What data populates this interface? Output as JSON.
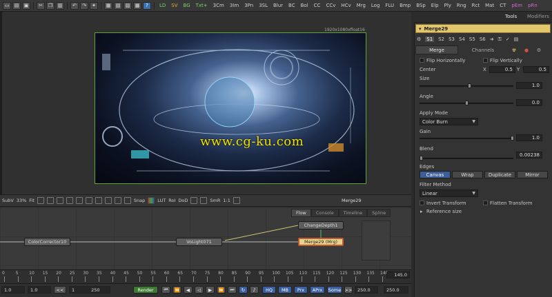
{
  "toolbar": {
    "tools": [
      "LD",
      "SV",
      "BG",
      "Txt+",
      "3Cm",
      "3Im",
      "3Pn",
      "3SL",
      "Blur",
      "BC",
      "Bol",
      "CC",
      "CCv",
      "HCv",
      "Mrg",
      "Log",
      "FLU",
      "Bmp",
      "BSp",
      "Elp",
      "Ply",
      "Rng",
      "Rct",
      "Mat",
      "CT",
      "pEm",
      "pRn"
    ]
  },
  "viewer": {
    "resolution": "1920x1080xfloat16",
    "watermark": "www.cg-ku.com"
  },
  "viewbar": {
    "subv": "SubV",
    "zoom": "33%",
    "fit": "Fit",
    "snap": "Snap",
    "lut": "LUT",
    "roi": "RoI",
    "dod": "DoD",
    "smr": "SmR",
    "ratio": "1:1",
    "title": "Merge29"
  },
  "flow": {
    "tabs": [
      "Flow",
      "Console",
      "Timeline",
      "Spline"
    ],
    "nodes": {
      "color_corrector": "ColorCorrector10",
      "volight": "VoLight071",
      "change_depth": "ChangeDepth1",
      "merge": "Merge29  (Mrg)"
    }
  },
  "timeline": {
    "ticks": [
      "0",
      "5",
      "10",
      "15",
      "20",
      "25",
      "30",
      "35",
      "40",
      "45",
      "50",
      "55",
      "60",
      "65",
      "70",
      "75",
      "80",
      "85",
      "90",
      "95",
      "100",
      "105",
      "110",
      "115",
      "120",
      "125",
      "130",
      "135",
      "140"
    ],
    "end_value": "145.0"
  },
  "playbar": {
    "start": "1.0",
    "render_start": "1.0",
    "step_back": "<<",
    "range_start": "1",
    "range_end": "250",
    "render": "Render",
    "hq": "HQ",
    "mb": "MB",
    "prx": "Prx",
    "aprx": "APrx",
    "some": "Some",
    "step_fwd": ">>",
    "render_end": "250.0",
    "global_end": "250.0"
  },
  "inspector": {
    "tabs": {
      "tools": "Tools",
      "modifiers": "Modifiers"
    },
    "tool_name": "Merge29",
    "versions": [
      "S1",
      "S2",
      "S3",
      "S4",
      "S5",
      "S6"
    ],
    "subtabs": {
      "merge": "Merge",
      "channels": "Channels"
    },
    "flip_h": "Flip Horizontally",
    "flip_v": "Flip Vertically",
    "center": {
      "label": "Center",
      "x_label": "X",
      "x": "0.5",
      "y_label": "Y",
      "y": "0.5"
    },
    "size": {
      "label": "Size",
      "value": "1.0"
    },
    "angle": {
      "label": "Angle",
      "value": "0.0"
    },
    "apply_mode": {
      "label": "Apply Mode",
      "value": "Color Burn"
    },
    "gain": {
      "label": "Gain",
      "value": "1.0"
    },
    "blend": {
      "label": "Blend",
      "value": "0.00238"
    },
    "edges": {
      "label": "Edges",
      "options": [
        "Canvas",
        "Wrap",
        "Duplicate",
        "Mirror"
      ]
    },
    "filter": {
      "label": "Filter Method",
      "value": "Linear"
    },
    "invert_transform": "Invert Transform",
    "flatten_transform": "Flatten Transform",
    "reference_size": "Reference size"
  }
}
